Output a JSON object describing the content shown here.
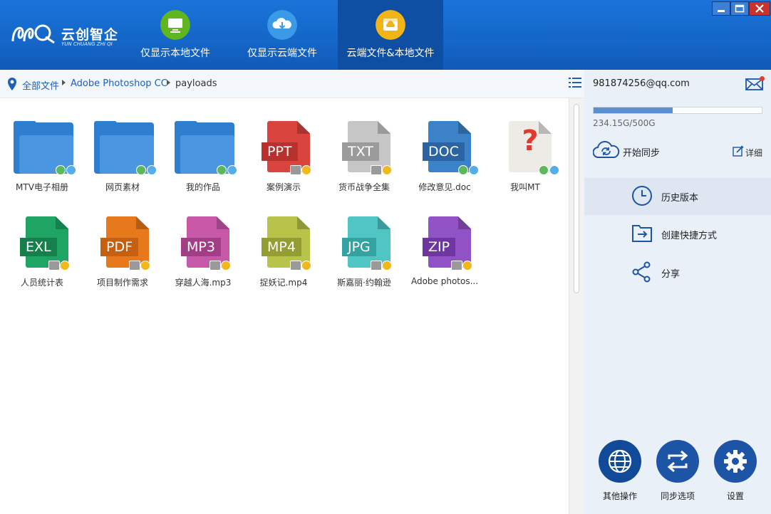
{
  "app": {
    "logo_cn": "云创智企",
    "logo_en": "YUN CHUANG ZHI QI"
  },
  "view_tabs": [
    {
      "label": "仅显示本地文件",
      "icon": "monitor-icon",
      "color": "#5fb61f",
      "active": false
    },
    {
      "label": "仅显示云端文件",
      "icon": "cloud-download-icon",
      "color": "#3a9ae6",
      "active": false
    },
    {
      "label": "云端文件&本地文件",
      "icon": "cloud-folder-icon",
      "color": "#f0b416",
      "active": true
    }
  ],
  "breadcrumb": {
    "root": "全部文件",
    "items": [
      "Adobe Photoshop CC",
      "payloads"
    ]
  },
  "files": [
    {
      "name": "MTV电子相册",
      "kind": "folder",
      "status": "local-cloud"
    },
    {
      "name": "网页素材",
      "kind": "folder",
      "status": "local-cloud"
    },
    {
      "name": "我的作品",
      "kind": "folder",
      "status": "local-cloud"
    },
    {
      "name": "案例演示",
      "kind": "doc",
      "badge": "PPT",
      "color": "#d9443f",
      "badge_color": "#b8312e",
      "status": "cloud-only"
    },
    {
      "name": "货币战争全集",
      "kind": "doc",
      "badge": "TXT",
      "color": "#c6c6c6",
      "badge_color": "#9b9b9b",
      "status": "cloud-only"
    },
    {
      "name": "修改意见.doc",
      "kind": "doc",
      "badge": "DOC",
      "color": "#3c82c8",
      "badge_color": "#2b64a3",
      "status": "local-cloud"
    },
    {
      "name": "我叫MT",
      "kind": "unknown",
      "badge": "?",
      "color": "#ecebe6",
      "badge_color": "#e03a30",
      "status": "local-cloud"
    },
    {
      "name": "人员统计表",
      "kind": "doc",
      "badge": "EXL",
      "color": "#1ea463",
      "badge_color": "#15804c",
      "status": "cloud-only"
    },
    {
      "name": "项目制作需求",
      "kind": "doc",
      "badge": "PDF",
      "color": "#e8781c",
      "badge_color": "#c55f12",
      "status": "cloud-only"
    },
    {
      "name": "穿越人海.mp3",
      "kind": "doc",
      "badge": "MP3",
      "color": "#c759a8",
      "badge_color": "#a13e85",
      "status": "cloud-only"
    },
    {
      "name": "捉妖记.mp4",
      "kind": "doc",
      "badge": "MP4",
      "color": "#b8c34a",
      "badge_color": "#939d31",
      "status": "cloud-only"
    },
    {
      "name": "斯嘉丽·约翰逊",
      "kind": "doc",
      "badge": "JPG",
      "color": "#4fc5c4",
      "badge_color": "#33a2a1",
      "status": "cloud-only"
    },
    {
      "name": "Adobe photos...",
      "kind": "doc",
      "badge": "ZIP",
      "color": "#9052c5",
      "badge_color": "#6f36a1",
      "status": "cloud-only"
    }
  ],
  "account": {
    "email": "981874256@qq.com",
    "storage_text": "234.15G/500G",
    "storage_fraction": 0.47
  },
  "sync": {
    "start_label": "开始同步",
    "detail_label": "详细"
  },
  "menu": [
    {
      "label": "历史版本",
      "icon": "clock-icon",
      "active": true
    },
    {
      "label": "创建快捷方式",
      "icon": "shortcut-icon",
      "active": false
    },
    {
      "label": "分享",
      "icon": "share-icon",
      "active": false
    }
  ],
  "bottom_actions": [
    {
      "label": "其他操作",
      "icon": "globe-icon"
    },
    {
      "label": "同步选项",
      "icon": "sync-arrows-icon"
    },
    {
      "label": "设置",
      "icon": "gear-icon"
    }
  ],
  "colors": {
    "header": "#1466c7",
    "active_tab": "#0e4fa3",
    "accent": "#1d55a6"
  }
}
